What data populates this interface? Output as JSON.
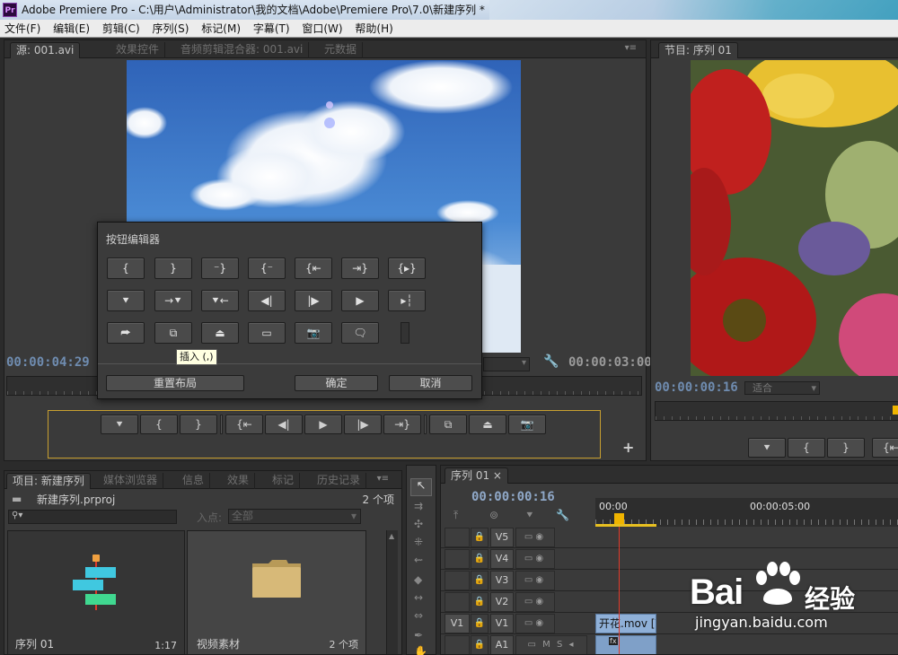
{
  "window": {
    "logo": "Pr",
    "title": "Adobe Premiere Pro - C:\\用户\\Administrator\\我的文档\\Adobe\\Premiere Pro\\7.0\\新建序列 *"
  },
  "menu": [
    "文件(F)",
    "编辑(E)",
    "剪辑(C)",
    "序列(S)",
    "标记(M)",
    "字幕(T)",
    "窗口(W)",
    "帮助(H)"
  ],
  "source_panel": {
    "tabs": [
      "源: 001.avi",
      "效果控件",
      "音频剪辑混合器: 001.avi",
      "元数据"
    ],
    "timecode_left": "00:00:04:29",
    "timecode_right": "00:00:03:00",
    "transport_buttons": [
      "marker",
      "mark-in",
      "mark-out",
      "go-to-in",
      "step-back",
      "play",
      "step-forward",
      "go-to-out",
      "insert",
      "overwrite",
      "export-frame"
    ]
  },
  "program_panel": {
    "tabs": [
      "节目: 序列 01"
    ],
    "timecode": "00:00:00:16",
    "fit_label": "适合"
  },
  "button_editor": {
    "title": "按钮编辑器",
    "tooltip": "插入 (,)",
    "reset_label": "重置布局",
    "ok_label": "确定",
    "cancel_label": "取消"
  },
  "project_panel": {
    "tabs": [
      "项目: 新建序列",
      "媒体浏览器",
      "信息",
      "效果",
      "标记",
      "历史记录"
    ],
    "project_file": "新建序列.prproj",
    "item_count": "2 个项",
    "in_point_label": "入点:",
    "in_point_value": "全部",
    "items": [
      {
        "name": "序列 01",
        "meta": "1:17"
      },
      {
        "name": "视频素材",
        "meta": "2 个项"
      }
    ]
  },
  "timeline_panel": {
    "tab": "序列 01",
    "timecode": "00:00:00:16",
    "ruler_labels": [
      "00:00",
      "00:00:05:00"
    ],
    "tracks": [
      {
        "name": "V5",
        "target": ""
      },
      {
        "name": "V4",
        "target": ""
      },
      {
        "name": "V3",
        "target": ""
      },
      {
        "name": "V2",
        "target": ""
      },
      {
        "name": "V1",
        "target": "V1"
      },
      {
        "name": "A1",
        "target": ""
      }
    ],
    "clip_label": "开花.mov [V]",
    "audio_clip_badge": "fx",
    "track_audio_toggles": "M S"
  },
  "watermark": {
    "brand": "Bai",
    "brand_cn": "经验",
    "url": "jingyan.baidu.com"
  },
  "colors": {
    "playhead": "#e03a2a",
    "playhead_handle": "#f0b400",
    "clip_video": "#8fb0d8",
    "clip_audio": "#7fa0c8",
    "transport_border": "#c8a030",
    "sequence_icon_blue": "#40c8e0",
    "sequence_icon_green": "#40d890",
    "folder": "#d7b978"
  }
}
